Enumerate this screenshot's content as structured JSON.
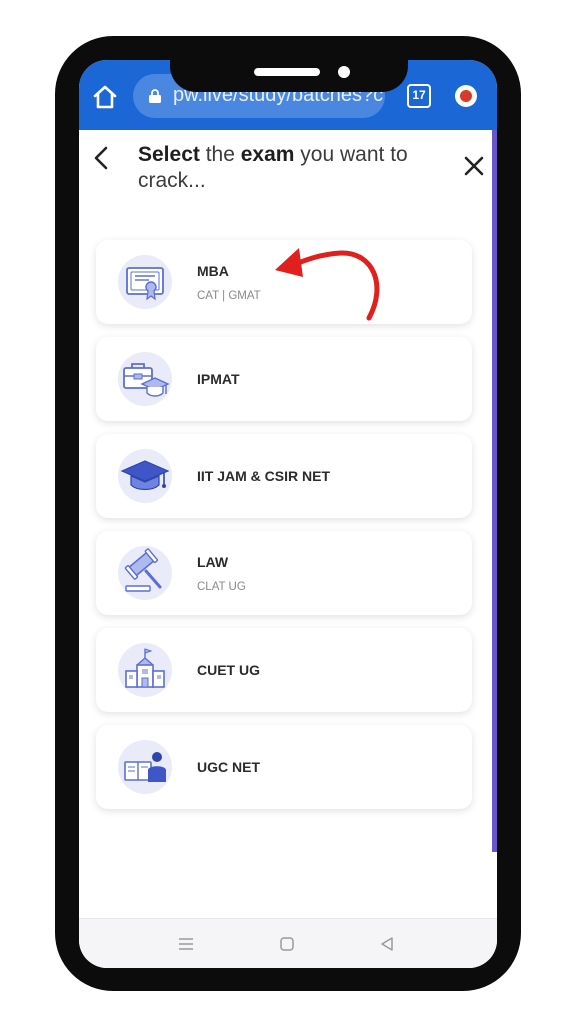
{
  "browser": {
    "url": "pw.live/study/batches?c",
    "tab_count": "17"
  },
  "header": {
    "title_bold_1": "Select",
    "title_part_2": " the ",
    "title_bold_3": "exam",
    "title_part_4": " you want to crack..."
  },
  "exams": [
    {
      "title": "MBA",
      "subtitle": "CAT | GMAT",
      "icon": "certificate-icon"
    },
    {
      "title": "IPMAT",
      "subtitle": "",
      "icon": "briefcase-graduation-icon"
    },
    {
      "title": "IIT JAM & CSIR NET",
      "subtitle": "",
      "icon": "graduation-cap-icon"
    },
    {
      "title": "LAW",
      "subtitle": "CLAT UG",
      "icon": "gavel-icon"
    },
    {
      "title": "CUET UG",
      "subtitle": "",
      "icon": "university-building-icon"
    },
    {
      "title": "UGC NET",
      "subtitle": "",
      "icon": "teacher-book-icon"
    }
  ],
  "colors": {
    "browser_bar": "#1c67d6",
    "accent_purple": "#6857c8",
    "arrow_red": "#e0201c",
    "icon_blue": "#5b6fd6"
  }
}
